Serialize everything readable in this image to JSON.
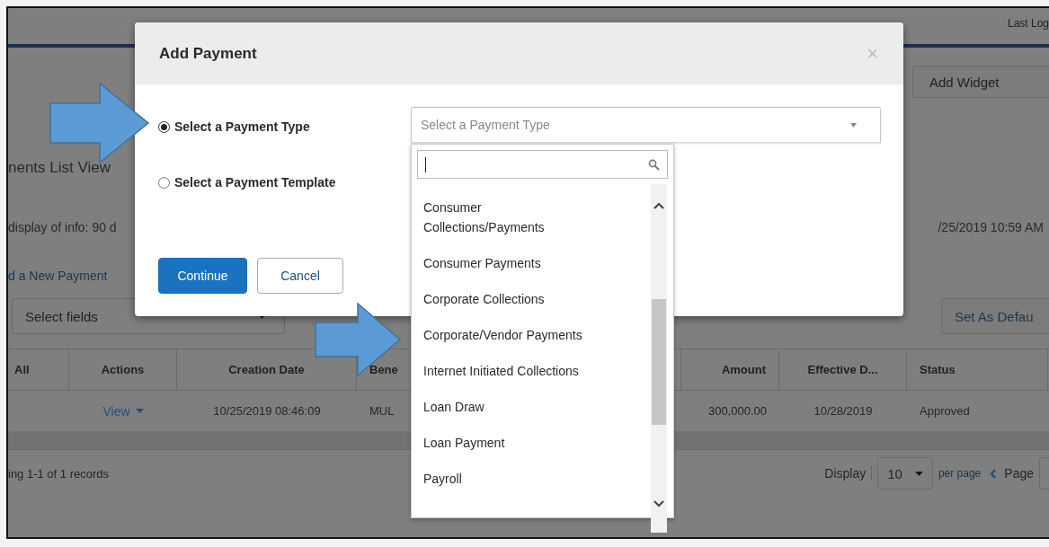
{
  "page": {
    "last_login": "Last Log",
    "add_widget": "Add Widget",
    "title": "nents List View",
    "info": "display of info: 90 d",
    "timestamp": "/25/2019 10:59 AM",
    "add_link": "d a New Payment",
    "select_fields": "Select fields",
    "set_default": "Set As Defau",
    "table": {
      "columns": [
        {
          "label": "All"
        },
        {
          "label": "Actions"
        },
        {
          "label": "Creation Date"
        },
        {
          "label": "Bene"
        },
        {
          "label": "Amount"
        },
        {
          "label": "Effective D..."
        },
        {
          "label": "Status"
        }
      ],
      "rows": [
        {
          "cells": [
            {
              "kind": "text",
              "text": ""
            },
            {
              "kind": "menu",
              "text": "View"
            },
            {
              "kind": "text",
              "text": "10/25/2019 08:46:09"
            },
            {
              "kind": "text",
              "text": "MUL"
            },
            {
              "kind": "text",
              "text": "300,000.00"
            },
            {
              "kind": "text",
              "text": "10/28/2019"
            },
            {
              "kind": "text",
              "text": "Approved"
            }
          ]
        }
      ]
    },
    "footer": {
      "records": "ing 1-1 of 1 records",
      "display": "Display",
      "per_page_value": "10",
      "per_page": "per page",
      "page": "Page"
    }
  },
  "modal": {
    "title": "Add Payment",
    "close": "×",
    "options": [
      {
        "label": "Select a Payment Type",
        "selected": true
      },
      {
        "label": "Select a Payment Template",
        "selected": false
      }
    ],
    "select": {
      "placeholder": "Select a Payment Type",
      "expanded": true
    },
    "buttons": [
      {
        "label": "Continue",
        "kind": "primary"
      },
      {
        "label": "Cancel",
        "kind": "secondary"
      }
    ]
  },
  "dropdown": {
    "items": [
      "Consumer Collections/Payments",
      "Consumer Payments",
      "Corporate Collections",
      "Corporate/Vendor Payments",
      "Internet Initiated Collections",
      "Loan Draw",
      "Loan Payment",
      "Payroll"
    ]
  }
}
